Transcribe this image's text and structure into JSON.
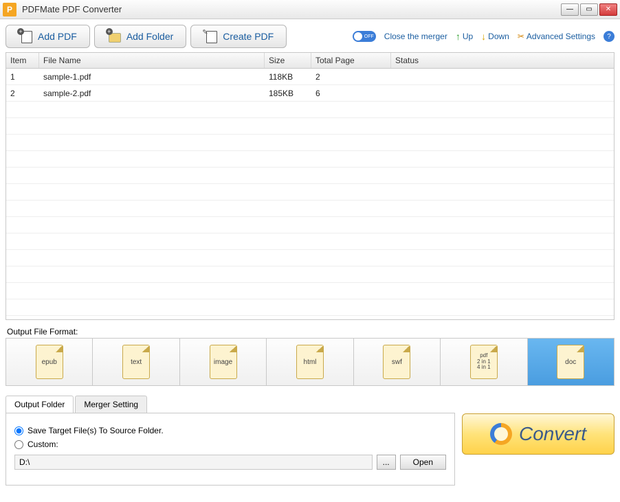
{
  "window": {
    "title": "PDFMate PDF Converter"
  },
  "toolbar": {
    "add_pdf": "Add PDF",
    "add_folder": "Add Folder",
    "create_pdf": "Create PDF",
    "switch_label": "OFF",
    "close_merger": "Close the merger",
    "up": "Up",
    "down": "Down",
    "advanced": "Advanced Settings"
  },
  "grid": {
    "headers": {
      "item": "Item",
      "file": "File Name",
      "size": "Size",
      "total": "Total Page",
      "status": "Status"
    },
    "rows": [
      {
        "item": "1",
        "file": "sample-1.pdf",
        "size": "118KB",
        "total": "2",
        "status": ""
      },
      {
        "item": "2",
        "file": "sample-2.pdf",
        "size": "185KB",
        "total": "6",
        "status": ""
      }
    ]
  },
  "formats": {
    "label": "Output File Format:",
    "items": [
      "epub",
      "text",
      "image",
      "html",
      "swf",
      "pdf\n2 in 1\n4 in 1",
      "doc"
    ],
    "selected": 6
  },
  "tabs": {
    "output_folder": "Output Folder",
    "merger_setting": "Merger Setting"
  },
  "output_panel": {
    "radio_source": "Save Target File(s) To Source Folder.",
    "radio_custom": "Custom:",
    "path": "D:\\",
    "browse": "...",
    "open": "Open"
  },
  "convert": "Convert"
}
